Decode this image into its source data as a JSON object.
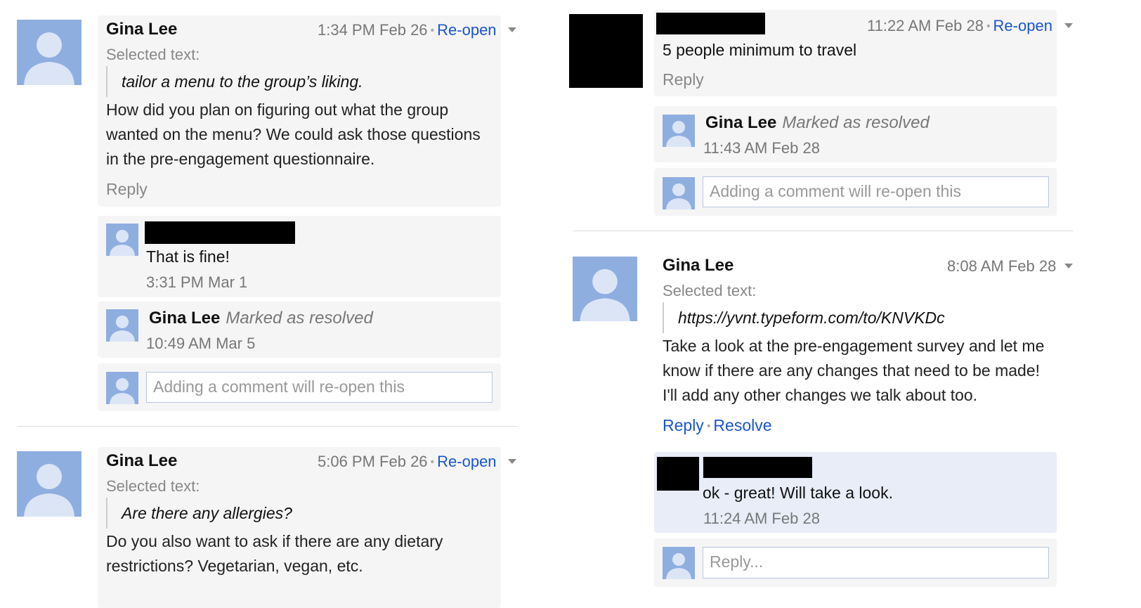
{
  "left": {
    "thread1": {
      "author": "Gina Lee",
      "time": "1:34 PM Feb 26",
      "reopen": "Re-open",
      "selected_label": "Selected text:",
      "quote": "tailor a menu to the group’s liking.",
      "body_lines": [
        "How did you plan on figuring out what the group",
        "wanted on the menu? We could ask those questions",
        "in the pre-engagement questionnaire."
      ],
      "reply": "Reply",
      "reply1": {
        "text": "That is fine!",
        "time": "3:31 PM Mar 1"
      },
      "resolved": {
        "author": "Gina Lee",
        "status": "Marked as resolved",
        "time": "10:49 AM Mar 5"
      },
      "input_placeholder": "Adding a comment will re-open this"
    },
    "thread2": {
      "author": "Gina Lee",
      "time": "5:06 PM Feb 26",
      "reopen": "Re-open",
      "selected_label": "Selected text:",
      "quote": "Are there any allergies?",
      "body_lines": [
        "Do you also want to ask if there are any dietary",
        "restrictions? Vegetarian, vegan, etc."
      ]
    }
  },
  "right": {
    "thread1": {
      "time": "11:22 AM Feb 28",
      "reopen": "Re-open",
      "body": "5 people minimum to travel",
      "reply": "Reply",
      "resolved": {
        "author": "Gina Lee",
        "status": "Marked as resolved",
        "time": "11:43 AM Feb 28"
      },
      "input_placeholder": "Adding a comment will re-open this"
    },
    "thread2": {
      "author": "Gina Lee",
      "time": "8:08 AM Feb 28",
      "selected_label": "Selected text:",
      "quote": "https://yvnt.typeform.com/to/KNVKDc",
      "body_lines": [
        "Take a look at the pre-engagement survey and let me",
        "know if there are any changes that need to be made!",
        "I'll add any other changes we talk about too."
      ],
      "reply": "Reply",
      "resolve": "Resolve",
      "reply1": {
        "text": "ok - great! Will take a look.",
        "time": "11:24 AM Feb 28"
      },
      "input_placeholder": "Reply..."
    }
  },
  "colors": {
    "avatar": "#8faee0",
    "link": "#1a55d0",
    "card": "#f5f5f5",
    "card_highlight": "#e8edf8"
  }
}
